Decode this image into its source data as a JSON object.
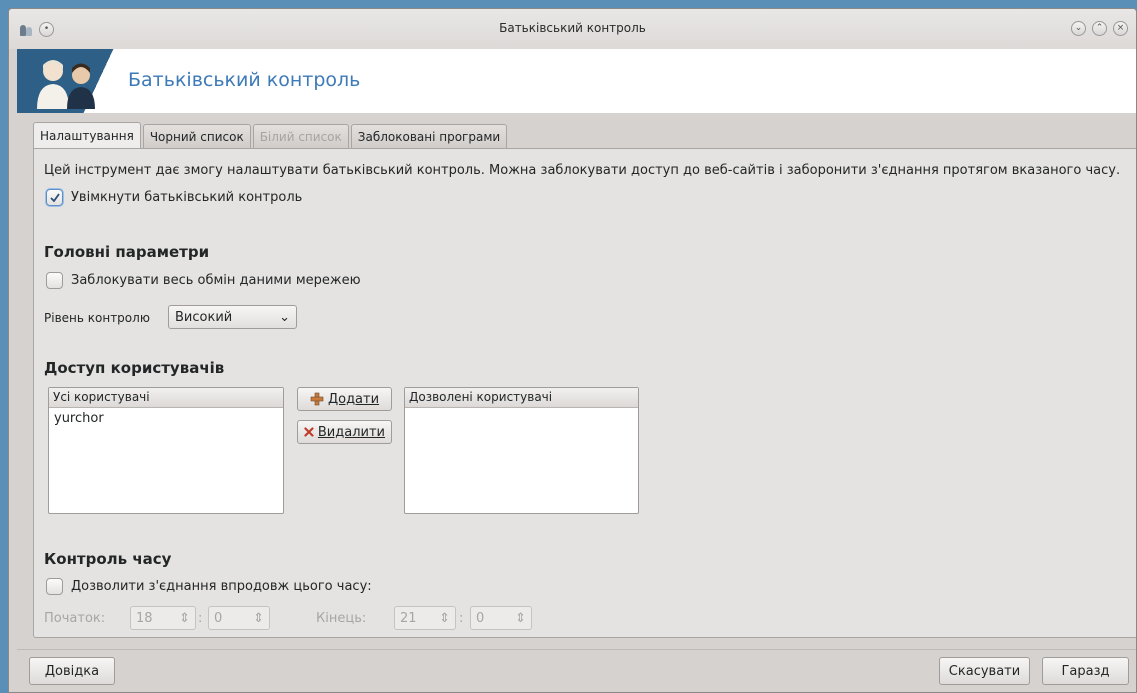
{
  "window": {
    "title": "Батьківський контроль"
  },
  "banner": {
    "title": "Батьківський контроль"
  },
  "tabs": [
    {
      "label": "Налаштування",
      "state": "active"
    },
    {
      "label": "Чорний список",
      "state": "normal"
    },
    {
      "label": "Білий список",
      "state": "disabled"
    },
    {
      "label": "Заблоковані програми",
      "state": "normal"
    }
  ],
  "main": {
    "description": "Цей інструмент дає змогу налаштувати батьківський контроль. Можна заблокувати доступ до веб-сайтів і заборонити з'єднання протягом вказаного часу.",
    "enable_label": "Увімкнути батьківський контроль",
    "enable_checked": true
  },
  "main_params": {
    "heading": "Головні параметри",
    "block_all_label": "Заблокувати весь обмін даними мережею",
    "block_all_checked": false,
    "level_label": "Рівень контролю",
    "level_value": "Високий"
  },
  "user_access": {
    "heading": "Доступ користувачів",
    "all_users_header": "Усі користувачі",
    "all_users": [
      "yurchor"
    ],
    "add_label": "Додати",
    "remove_label": "Видалити",
    "allowed_users_header": "Дозволені користувачі",
    "allowed_users": []
  },
  "time_control": {
    "heading": "Контроль часу",
    "allow_label": "Дозволити з'єднання впродовж цього часу:",
    "allow_checked": false,
    "start_label": "Початок:",
    "start_hour": "18",
    "start_minute": "0",
    "end_label": "Кінець:",
    "end_hour": "21",
    "end_minute": "0",
    "separator": ":"
  },
  "footer": {
    "help_label": "Довідка",
    "cancel_label": "Скасувати",
    "ok_label": "Гаразд"
  },
  "colors": {
    "accent": "#3d7ab8",
    "banner_icon_bg": "#2e5f87"
  }
}
